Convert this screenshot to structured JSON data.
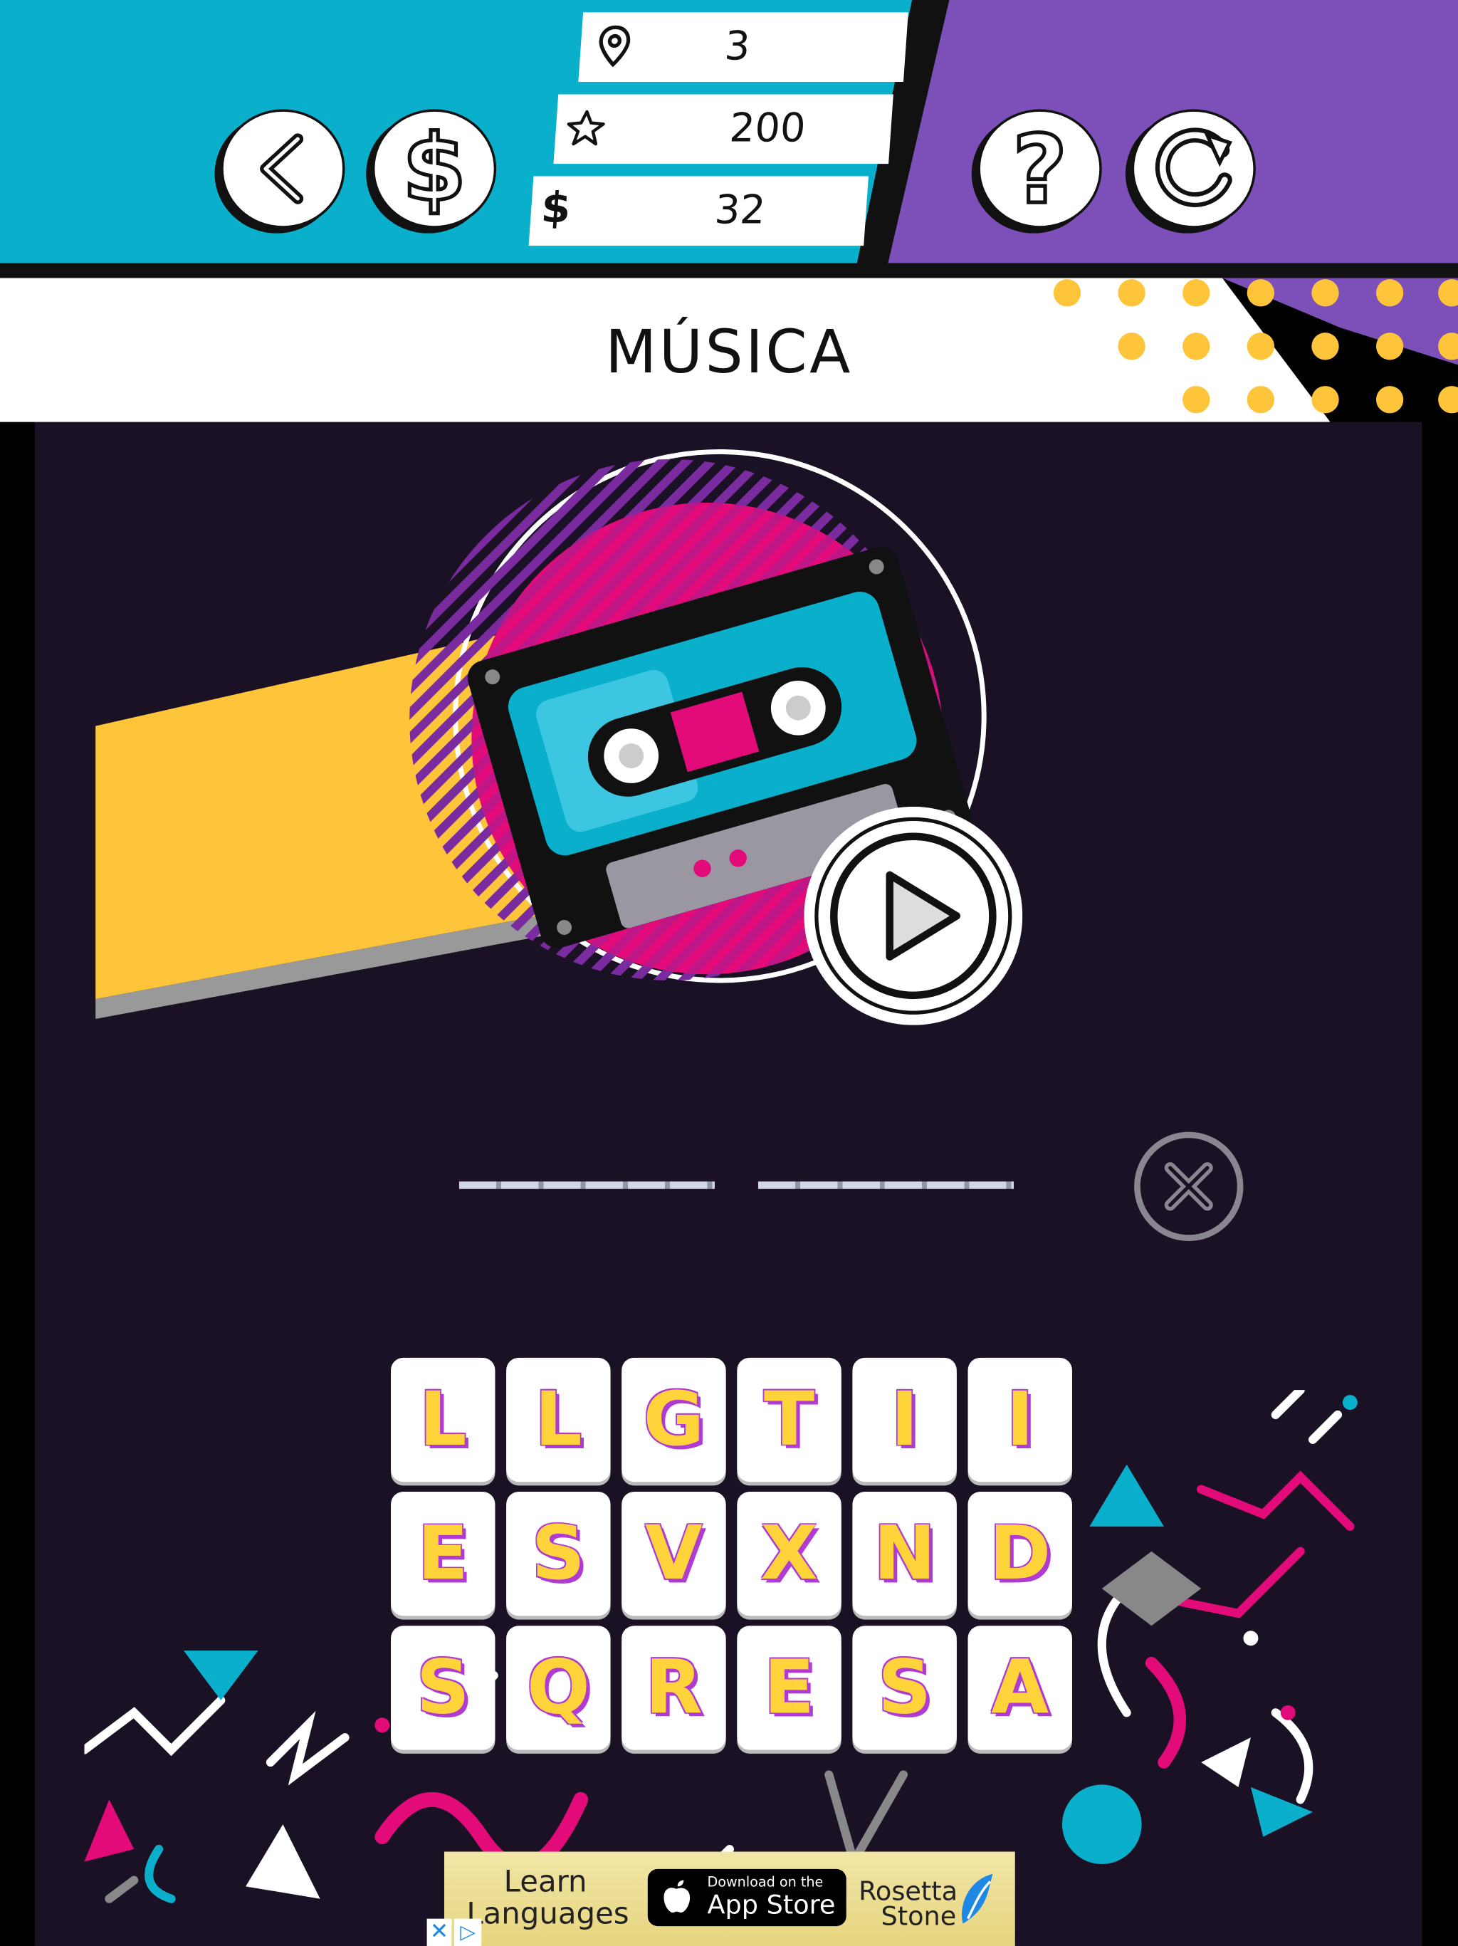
{
  "header": {
    "stats": [
      {
        "icon": "map-pin-icon",
        "value": "3"
      },
      {
        "icon": "star-icon",
        "value": "200"
      },
      {
        "icon": "dollar-icon",
        "value": "32"
      }
    ],
    "buttons": {
      "back": "back-arrow-icon",
      "shop": "dollar-icon",
      "help": "question-mark-icon",
      "restart": "restart-icon"
    }
  },
  "category": {
    "title": "MÚSICA"
  },
  "colors": {
    "cyan": "#0aafcc",
    "purple": "#7d4fb8",
    "dark": "#1b1124",
    "yellow": "#ffc53a",
    "pink": "#e30a79",
    "tile_letter": "#ffd33a",
    "tile_outline": "#b03ad4"
  },
  "answer": {
    "word_lengths": [
      6,
      6
    ]
  },
  "tiles": [
    [
      "L",
      "L",
      "G",
      "T",
      "I",
      "I"
    ],
    [
      "E",
      "S",
      "V",
      "X",
      "N",
      "D"
    ],
    [
      "S",
      "Q",
      "R",
      "E",
      "S",
      "A"
    ]
  ],
  "ad": {
    "line1": "Learn",
    "line2": "Languages",
    "store_small": "Download on the",
    "store_big": "App Store",
    "brand1": "Rosetta",
    "brand2": "Stone"
  }
}
